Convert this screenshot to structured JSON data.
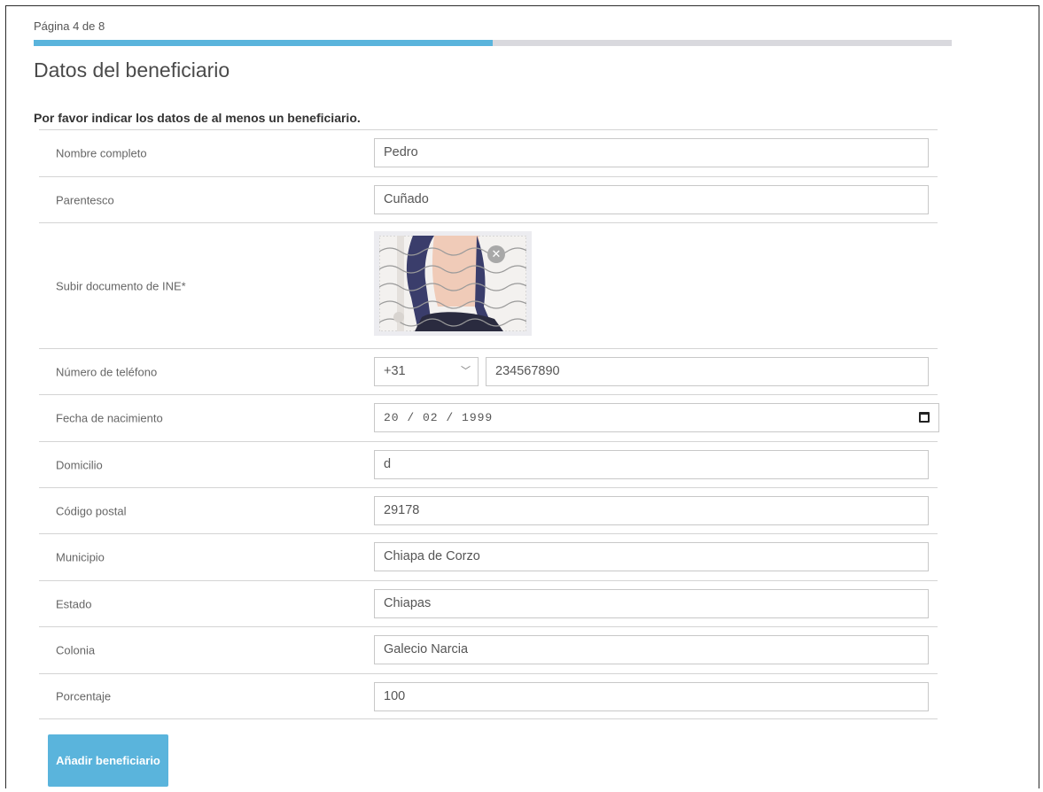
{
  "page_indicator": "Página 4 de 8",
  "progress": {
    "current_page": 4,
    "total_pages": 8,
    "fraction": 0.5,
    "fill_color": "#5ab4dc",
    "track_color": "#d9d9de"
  },
  "section_title": "Datos del beneficiario",
  "instruction": "Por favor indicar los datos de al menos un beneficiario.",
  "fields": {
    "nombre": {
      "label": "Nombre completo",
      "value": "Pedro"
    },
    "parentesco": {
      "label": "Parentesco",
      "value": "Cuñado"
    },
    "ine": {
      "label": "Subir documento de INE*",
      "remove_icon": "close-icon"
    },
    "telefono": {
      "label": "Número de teléfono",
      "country_code": "+31",
      "value": "234567890"
    },
    "nacimiento": {
      "label": "Fecha de nacimiento",
      "value": "20/02/1999",
      "icon": "calendar-icon"
    },
    "domicilio": {
      "label": "Domicilio",
      "value": "d"
    },
    "codigo_postal": {
      "label": "Código postal",
      "value": "29178"
    },
    "municipio": {
      "label": "Municipio",
      "value": "Chiapa de Corzo"
    },
    "estado": {
      "label": "Estado",
      "value": "Chiapas"
    },
    "colonia": {
      "label": "Colonia",
      "value": "Galecio Narcia"
    },
    "porcentaje": {
      "label": "Porcentaje",
      "value": "100"
    }
  },
  "add_button": {
    "label": "Añadir beneficiario",
    "color": "#5ab4dc"
  }
}
